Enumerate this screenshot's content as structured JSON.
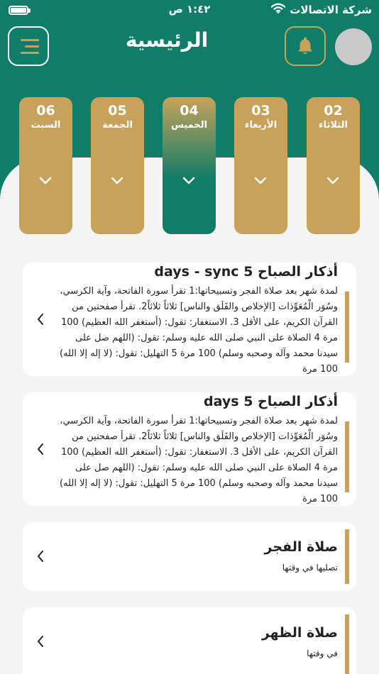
{
  "status": {
    "carrier": "شركة الاتصالات",
    "time": "١:٤٢ ص"
  },
  "header": {
    "title": "الرئيسية"
  },
  "days": [
    {
      "num": "06",
      "name": "السبت"
    },
    {
      "num": "05",
      "name": "الجمعة"
    },
    {
      "num": "04",
      "name": "الخميس",
      "active": true
    },
    {
      "num": "03",
      "name": "الأربعاء"
    },
    {
      "num": "02",
      "name": "الثلاثاء"
    }
  ],
  "cards": [
    {
      "title": "أذكار الصباح 5 days - sync",
      "body": "لمدة شهر بعد صلاة الفجر وتسبيحاتها:1 تقرأ سورة الفاتحة، وآية الكرسي، وسُوَر الْمُعَوِّذات [الإخلاص والفَلَق والناس] ثلاثاً ثلاثاً2. تقرأ صفحتين من القرآن الكريم، على الأقل 3. الاستغفار: تقول: (أستغفر الله العظيم) 100 مرة 4 الصلاة على النبي صلى الله عليه وسلم: تقول: (اللهم صل على سيدنا محمد وآله وصحبه وسلم) 100 مرة 5 التهليل: تقول: (لا إله إلا الله) 100 مرة"
    },
    {
      "title": "أذكار الصباح 5 days",
      "body": "لمدة شهر بعد صلاة الفجر وتسبيحاتها:1 تقرأ سورة الفاتحة، وآية الكرسي، وسُوَر الْمُعَوِّذات [الإخلاص والفَلَق والناس] ثلاثاً ثلاثاً2. تقرأ صفحتين من القرآن الكريم، على الأقل 3. الاستغفار: تقول: (أستغفر الله العظيم) 100 مرة 4 الصلاة على النبي صلى الله عليه وسلم: تقول: (اللهم صل على سيدنا محمد وآله وصحبه وسلم) 100 مرة 5 التهليل: تقول: (لا إله إلا الله) 100 مرة"
    },
    {
      "title": "صلاة الفجر",
      "subtitle": "تصليها في وقتها"
    },
    {
      "title": "صلاة الظهر",
      "subtitle": "في وقتها"
    }
  ],
  "colors": {
    "primary": "#0f7d68",
    "accent": "#c8a25a",
    "background": "#f4f4f4"
  },
  "icons": {
    "menu": "menu-icon",
    "notifications": "bell-icon",
    "day_expand": "chevron-down-icon",
    "card_open": "chevron-left-icon"
  }
}
